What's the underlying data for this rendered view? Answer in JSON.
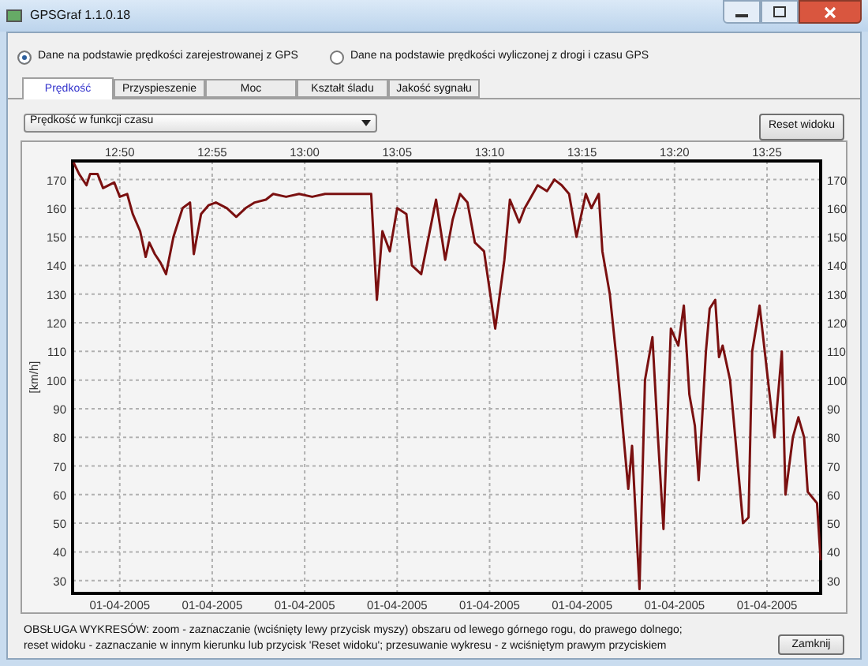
{
  "window": {
    "title": "GPSGraf 1.1.0.18"
  },
  "data_source": [
    {
      "label": "Dane na podstawie prędkości zarejestrowanej z GPS",
      "selected": true
    },
    {
      "label": "Dane na podstawie prędkości wyliczonej z drogi i czasu GPS",
      "selected": false
    }
  ],
  "tabs": [
    {
      "label": "Prędkość",
      "selected": true
    },
    {
      "label": "Przyspieszenie",
      "selected": false
    },
    {
      "label": "Moc",
      "selected": false
    },
    {
      "label": "Kształt śladu",
      "selected": false
    },
    {
      "label": "Jakość sygnału",
      "selected": false
    }
  ],
  "chart_select": {
    "value": "Prędkość w funkcji czasu"
  },
  "reset_button": "Reset widoku",
  "chart": {
    "chart_data": {
      "type": "line",
      "ylabel": "[km/h]",
      "x": [
        767.5,
        767.8,
        768.2,
        768.4,
        768.8,
        769.1,
        769.7,
        770,
        770.4,
        770.7,
        771.1,
        771.4,
        771.6,
        771.9,
        772.2,
        772.5,
        772.9,
        773.4,
        773.8,
        774.0,
        774.4,
        774.8,
        775.2,
        775.8,
        776.3,
        776.8,
        777.3,
        777.9,
        778.3,
        779.0,
        779.7,
        780.4,
        781.1,
        781.6,
        783.6,
        783.9,
        784.2,
        784.6,
        785.0,
        785.5,
        785.8,
        786.3,
        786.7,
        787.1,
        787.6,
        788.0,
        788.4,
        788.8,
        789.2,
        789.7,
        790.3,
        790.8,
        791.1,
        791.6,
        791.9,
        792.6,
        793.1,
        793.5,
        793.9,
        794.3,
        794.7,
        795.2,
        795.5,
        795.9,
        796.1,
        796.5,
        796.9,
        797.5,
        797.7,
        798.1,
        798.4,
        798.8,
        799.1,
        799.4,
        799.8,
        800.2,
        800.5,
        800.8,
        801.1,
        801.3,
        801.7,
        801.9,
        802.2,
        802.4,
        802.6,
        803.0,
        803.7,
        804.0,
        804.2,
        804.5,
        804.6,
        805.4,
        805.8,
        806.0,
        806.4,
        806.7,
        807.0,
        807.2,
        807.7,
        807.9
      ],
      "series": [
        {
          "color": "#7a1010",
          "values": [
            176,
            172,
            168,
            172,
            172,
            167,
            169,
            164,
            165,
            158,
            152,
            143,
            148,
            144,
            141,
            137,
            150,
            160,
            162,
            144,
            158,
            161,
            162,
            160,
            157,
            160,
            162,
            163,
            165,
            164,
            165,
            164,
            165,
            165,
            165,
            128,
            152,
            145,
            160,
            158,
            140,
            137,
            150,
            163,
            142,
            156,
            165,
            162,
            148,
            145,
            118,
            142,
            163,
            155,
            160,
            168,
            166,
            170,
            168,
            165,
            150,
            165,
            160,
            165,
            145,
            130,
            105,
            62,
            77,
            27,
            100,
            115,
            80,
            48,
            118,
            112,
            126,
            95,
            84,
            65,
            110,
            125,
            128,
            108,
            112,
            100,
            50,
            52,
            110,
            122,
            126,
            80,
            110,
            60,
            80,
            87,
            80,
            61,
            57,
            37
          ]
        }
      ],
      "grid": true,
      "xlim": [
        767.45,
        807.9
      ],
      "ylim": [
        25.5,
        176.5
      ],
      "xticks": [
        {
          "value": 770,
          "label": "12:50"
        },
        {
          "value": 775,
          "label": "12:55"
        },
        {
          "value": 780,
          "label": "13:00"
        },
        {
          "value": 785,
          "label": "13:05"
        },
        {
          "value": 790,
          "label": "13:10"
        },
        {
          "value": 795,
          "label": "13:15"
        },
        {
          "value": 800,
          "label": "13:20"
        },
        {
          "value": 805,
          "label": "13:25"
        }
      ],
      "yticks": [
        30,
        40,
        50,
        60,
        70,
        80,
        90,
        100,
        110,
        120,
        130,
        140,
        150,
        160,
        170
      ]
    },
    "right_axis_labels": [
      "170",
      "160",
      "150",
      "140",
      "130",
      "120",
      "110",
      "100",
      "90",
      "80",
      "70",
      "60",
      "50",
      "40",
      "30"
    ],
    "date_labels": [
      "01-04-2005",
      "01-04-2005",
      "01-04-2005",
      "01-04-2005",
      "01-04-2005",
      "01-04-2005",
      "01-04-2005",
      "01-04-2005"
    ]
  },
  "help_text": [
    "OBSŁUGA WYKRESÓW: zoom - zaznaczanie (wciśnięty lewy przycisk myszy) obszaru od lewego górnego rogu, do prawego dolnego;",
    "reset widoku - zaznaczanie w innym kierunku lub przycisk 'Reset widoku'; przesuwanie wykresu - z wciśniętym prawym przyciskiem"
  ],
  "close_button": "Zamknij"
}
